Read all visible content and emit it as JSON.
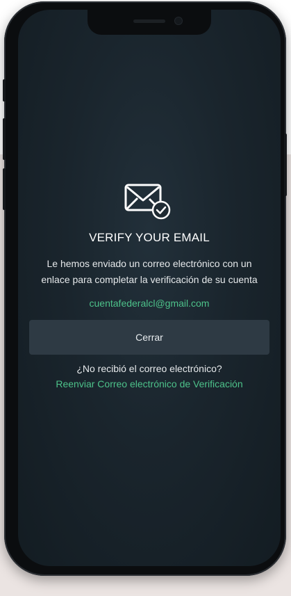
{
  "icon": "email-verified-icon",
  "verify": {
    "title": "VERIFY YOUR EMAIL",
    "message_line1": "Le hemos enviado un correo electrónico con un",
    "message_line2": "enlace para completar la verificación de su cuenta",
    "email": "cuentafederalcl@gmail.com",
    "close_label": "Cerrar",
    "not_received": "¿No recibió el correo electrónico?",
    "resend_label": "Reenviar Correo electrónico de Verificación"
  },
  "colors": {
    "accent": "#4dc28a",
    "button_bg": "#2e3a44",
    "screen_bg": "#1a252d"
  }
}
